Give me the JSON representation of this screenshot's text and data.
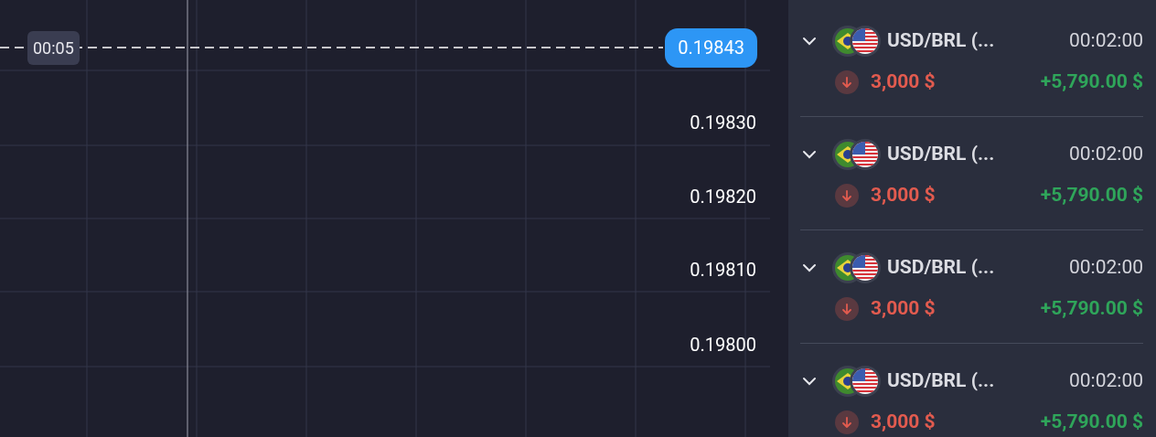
{
  "chart": {
    "timer": "00:05",
    "current_price": "0.19843",
    "price_labels": [
      "0.19830",
      "0.19820",
      "0.19810",
      "0.19800"
    ]
  },
  "trades": [
    {
      "pair": "USD/BRL (...",
      "time": "00:02:00",
      "falling": true,
      "amount": "3,000 $",
      "profit": "+5,790.00 $",
      "expanded": false
    },
    {
      "pair": "USD/BRL (...",
      "time": "00:02:00",
      "falling": true,
      "amount": "3,000 $",
      "profit": "+5,790.00 $",
      "expanded": false
    },
    {
      "pair": "USD/BRL (...",
      "time": "00:02:00",
      "falling": true,
      "amount": "3,000 $",
      "profit": "+5,790.00 $",
      "expanded": false
    },
    {
      "pair": "USD/BRL (...",
      "time": "00:02:00",
      "falling": true,
      "amount": "3,000 $",
      "profit": "+5,790.00 $",
      "expanded": false
    }
  ]
}
